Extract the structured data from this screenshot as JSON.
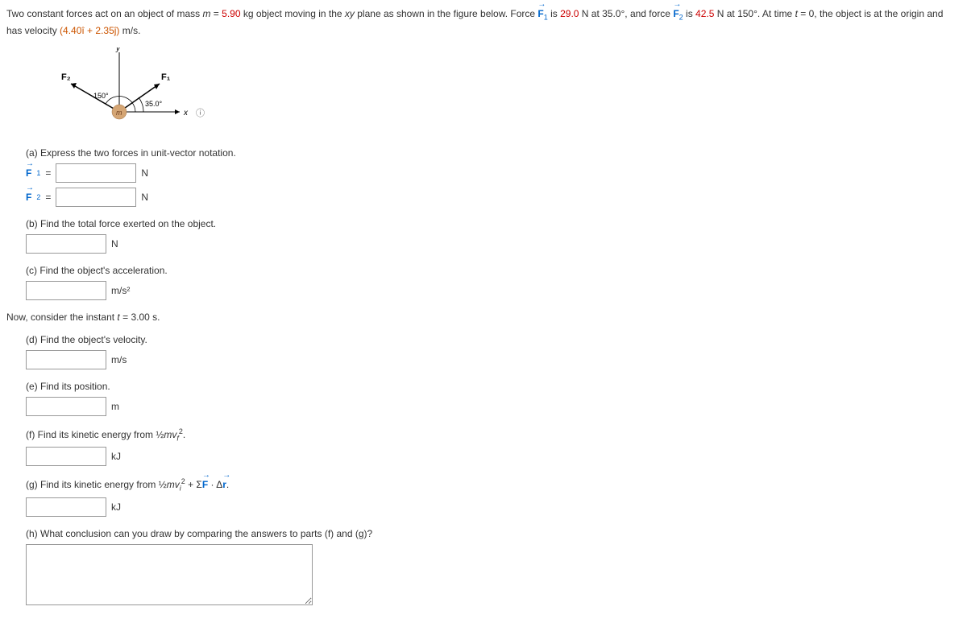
{
  "problem": {
    "intro_a": "Two constant forces act on an object of mass ",
    "m_var": "m",
    "eq": " = ",
    "mass": "5.90",
    "intro_b": " kg object moving in the ",
    "xy": "xy",
    "intro_c": " plane as shown in the figure below. Force ",
    "F": "F",
    "sub1": "1",
    "intro_d": " is ",
    "f1v": "29.0",
    "intro_e": " N at 35.0°, and force ",
    "sub2": "2",
    "intro_f": " is ",
    "f2v": "42.5",
    "intro_g": " N at 150°. At time ",
    "t": "t",
    "intro_h": " = 0, the object is at the origin and has velocity ",
    "vel": "(4.40î + 2.35ĵ)",
    "intro_i": " m/s."
  },
  "parts": {
    "a": {
      "label": "(a) Express the two forces in unit-vector notation.",
      "unit": "N"
    },
    "b": {
      "label": "(b) Find the total force exerted on the object.",
      "unit": "N"
    },
    "c": {
      "label": "(c) Find the object's acceleration.",
      "unit": "m/s²"
    },
    "d": {
      "label": "(d) Find the object's velocity.",
      "unit": "m/s"
    },
    "e": {
      "label": "(e) Find its position.",
      "unit": "m"
    },
    "f": {
      "label_a": "(f) Find its kinetic energy from ½",
      "label_b": ".",
      "unit": "kJ"
    },
    "g": {
      "label_a": "(g) Find its kinetic energy from ½",
      "label_b": " + Σ",
      "label_c": " · Δ",
      "label_d": ".",
      "unit": "kJ"
    },
    "h": {
      "label": "(h) What conclusion can you draw by comparing the answers to parts (f) and (g)?"
    }
  },
  "now": {
    "a": "Now, consider the instant ",
    "t": "t",
    "b": " = 3.00 s."
  },
  "diagram": {
    "y": "y",
    "x": "x",
    "F1": "F₁",
    "F2": "F₂",
    "angle150": "150°",
    "angle35": "35.0°",
    "m": "m"
  },
  "info_icon": "i"
}
